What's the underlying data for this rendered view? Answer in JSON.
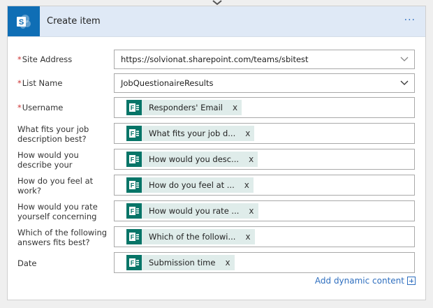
{
  "header": {
    "title": "Create item",
    "menu_label": "···",
    "icon": "sharepoint-icon"
  },
  "fields": {
    "site_address": {
      "label": "Site Address",
      "required": true,
      "value": "https://solvionat.sharepoint.com/teams/sbitest"
    },
    "list_name": {
      "label": "List Name",
      "required": true,
      "value": "JobQuestionaireResults"
    },
    "username": {
      "label": "Username",
      "required": true,
      "token": "Responders' Email"
    },
    "job_description": {
      "label": "What fits your job description best?",
      "token": "What fits your job d..."
    },
    "describe_your": {
      "label": "How would you describe your",
      "token": "How would you desc..."
    },
    "feel_at_work": {
      "label": "How do you feel at work?",
      "token": "How do you feel at ..."
    },
    "rate_concerning": {
      "label": "How would you rate yourself concerning",
      "token": "How would you rate ..."
    },
    "answers_fit": {
      "label": "Which of the following answers fits best?",
      "token": "Which of the followi..."
    },
    "date": {
      "label": "Date",
      "token": "Submission time"
    }
  },
  "token_remove": "x",
  "footer": {
    "add_dynamic_label": "Add dynamic content"
  },
  "colors": {
    "sharepoint": "#0f6eb5",
    "forms": "#077568",
    "token_bg": "#dfecea",
    "link": "#2f6fbf",
    "header_bg": "#dfe9f6"
  }
}
